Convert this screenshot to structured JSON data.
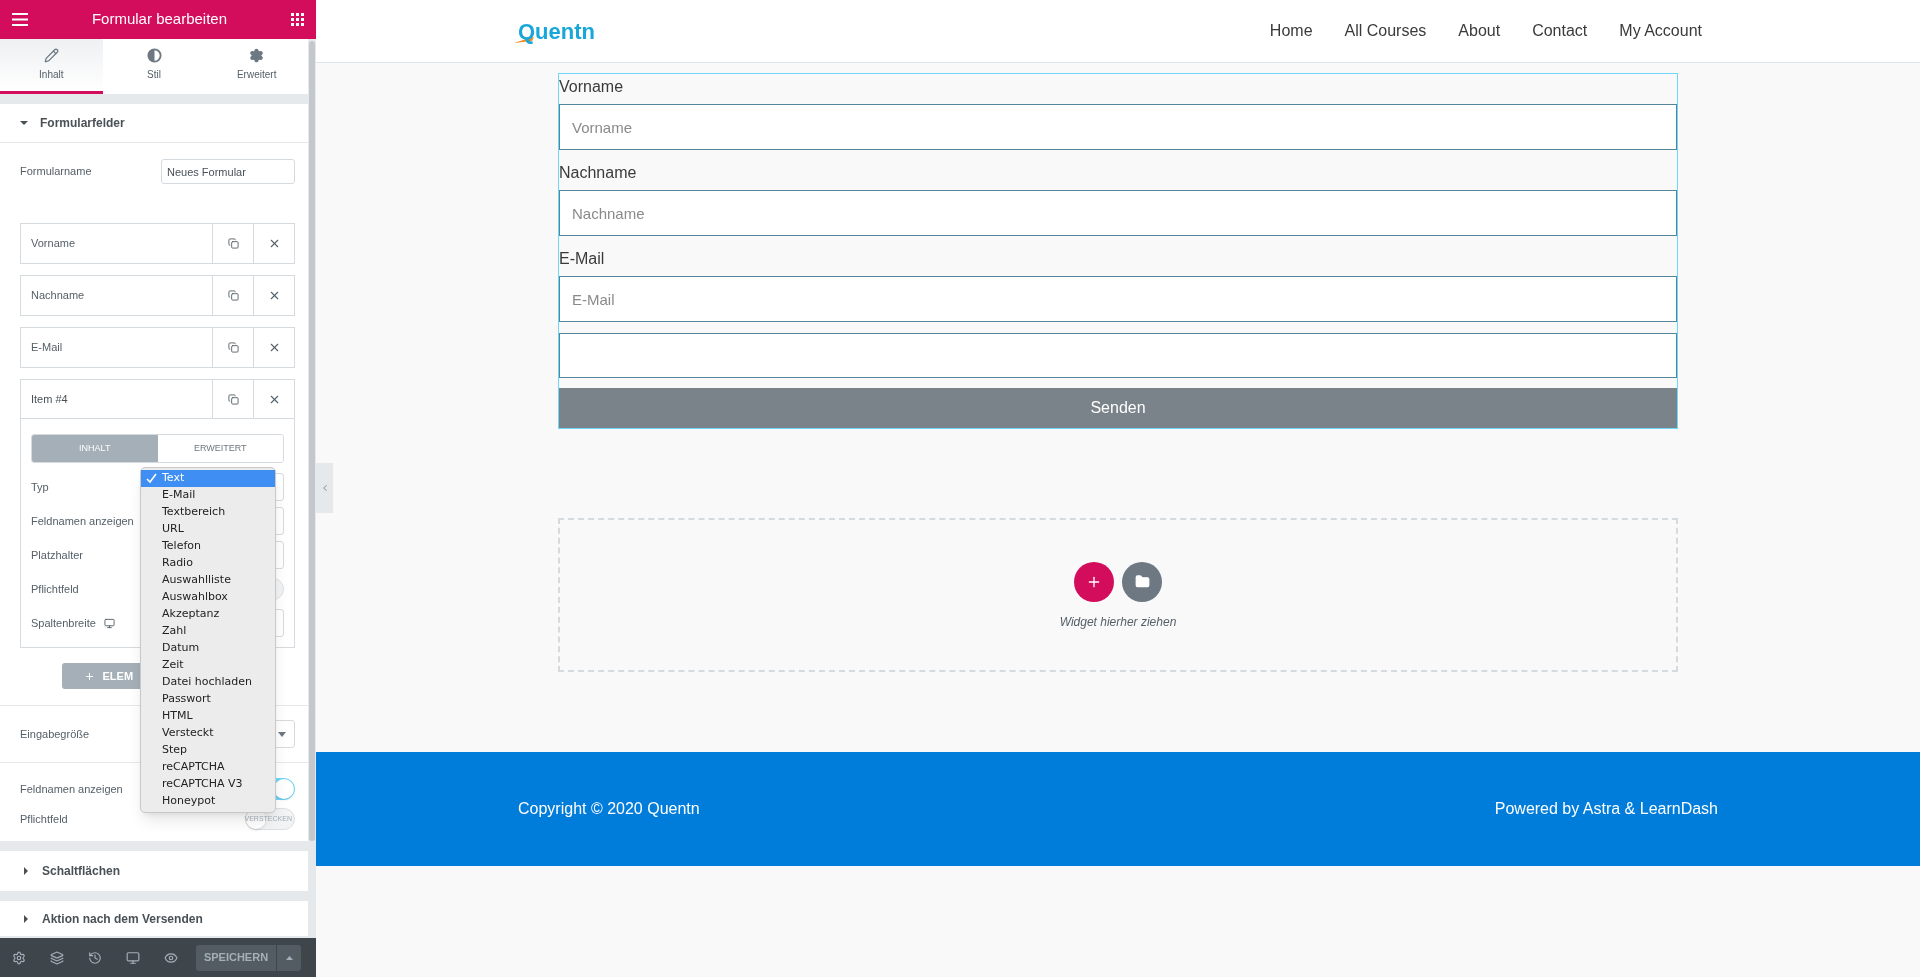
{
  "editor": {
    "title": "Formular bearbeiten",
    "tabs": [
      {
        "label": "Inhalt",
        "selected": true
      },
      {
        "label": "Stil",
        "selected": false
      },
      {
        "label": "Erweitert",
        "selected": false
      }
    ],
    "form_fields": {
      "title": "Formularfelder",
      "expanded": true,
      "form_name": {
        "label": "Formularname",
        "value": "Neues Formular"
      },
      "items": [
        {
          "label": "Vorname",
          "expanded": false
        },
        {
          "label": "Nachname",
          "expanded": false
        },
        {
          "label": "E-Mail",
          "expanded": false
        },
        {
          "label": "Item #4",
          "expanded": true
        }
      ],
      "item_tabs": [
        {
          "label": "INHALT",
          "selected": true
        },
        {
          "label": "ERWEITERT",
          "selected": false
        }
      ],
      "item_settings": [
        {
          "label": "Typ",
          "kind": "select"
        },
        {
          "label": "Feldnamen anzeigen",
          "kind": "text"
        },
        {
          "label": "Platzhalter",
          "kind": "text"
        },
        {
          "label": "Pflichtfeld",
          "kind": "toggle",
          "on": false
        },
        {
          "label": "Spaltenbreite",
          "kind": "select",
          "responsive": true
        }
      ],
      "add_button": "ELEM",
      "settings": [
        {
          "label": "Eingabegröße",
          "kind": "select"
        },
        {
          "label": "Feldnamen anzeigen",
          "kind": "toggle",
          "on": true
        },
        {
          "label": "Pflichtfeld",
          "kind": "toggle",
          "on": false,
          "off_label": "VERSTECKEN"
        }
      ]
    },
    "collapsed_sections": [
      {
        "title": "Schaltflächen",
        "expanded": false
      },
      {
        "title": "Aktion nach dem Versenden",
        "expanded": false
      }
    ],
    "bottom_bar": {
      "save": "SPEICHERN"
    },
    "type_dropdown": [
      {
        "label": "Text",
        "selected": true
      },
      {
        "label": "E-Mail",
        "selected": false
      },
      {
        "label": "Textbereich",
        "selected": false
      },
      {
        "label": "URL",
        "selected": false
      },
      {
        "label": "Telefon",
        "selected": false
      },
      {
        "label": "Radio",
        "selected": false
      },
      {
        "label": "Auswahlliste",
        "selected": false
      },
      {
        "label": "Auswahlbox",
        "selected": false
      },
      {
        "label": "Akzeptanz",
        "selected": false
      },
      {
        "label": "Zahl",
        "selected": false
      },
      {
        "label": "Datum",
        "selected": false
      },
      {
        "label": "Zeit",
        "selected": false
      },
      {
        "label": "Datei hochladen",
        "selected": false
      },
      {
        "label": "Passwort",
        "selected": false
      },
      {
        "label": "HTML",
        "selected": false
      },
      {
        "label": "Versteckt",
        "selected": false
      },
      {
        "label": "Step",
        "selected": false
      },
      {
        "label": "reCAPTCHA",
        "selected": false
      },
      {
        "label": "reCAPTCHA V3",
        "selected": false
      },
      {
        "label": "Honeypot",
        "selected": false
      }
    ]
  },
  "site": {
    "logo": "Quentn",
    "nav": [
      "Home",
      "All Courses",
      "About",
      "Contact",
      "My Account"
    ],
    "form": {
      "fields": [
        {
          "kind": "labeled",
          "label": "Vorname",
          "placeholder": "Vorname"
        },
        {
          "kind": "labeled",
          "label": "Nachname",
          "placeholder": "Nachname"
        },
        {
          "kind": "labeled",
          "label": "E-Mail",
          "placeholder": "E-Mail"
        },
        {
          "kind": "plain"
        }
      ],
      "submit": "Senden"
    },
    "drop_zone": {
      "hint": "Widget hierher ziehen"
    },
    "footer": {
      "left": "Copyright © 2020 Quentn",
      "right": "Powered by Astra & LearnDash"
    }
  }
}
